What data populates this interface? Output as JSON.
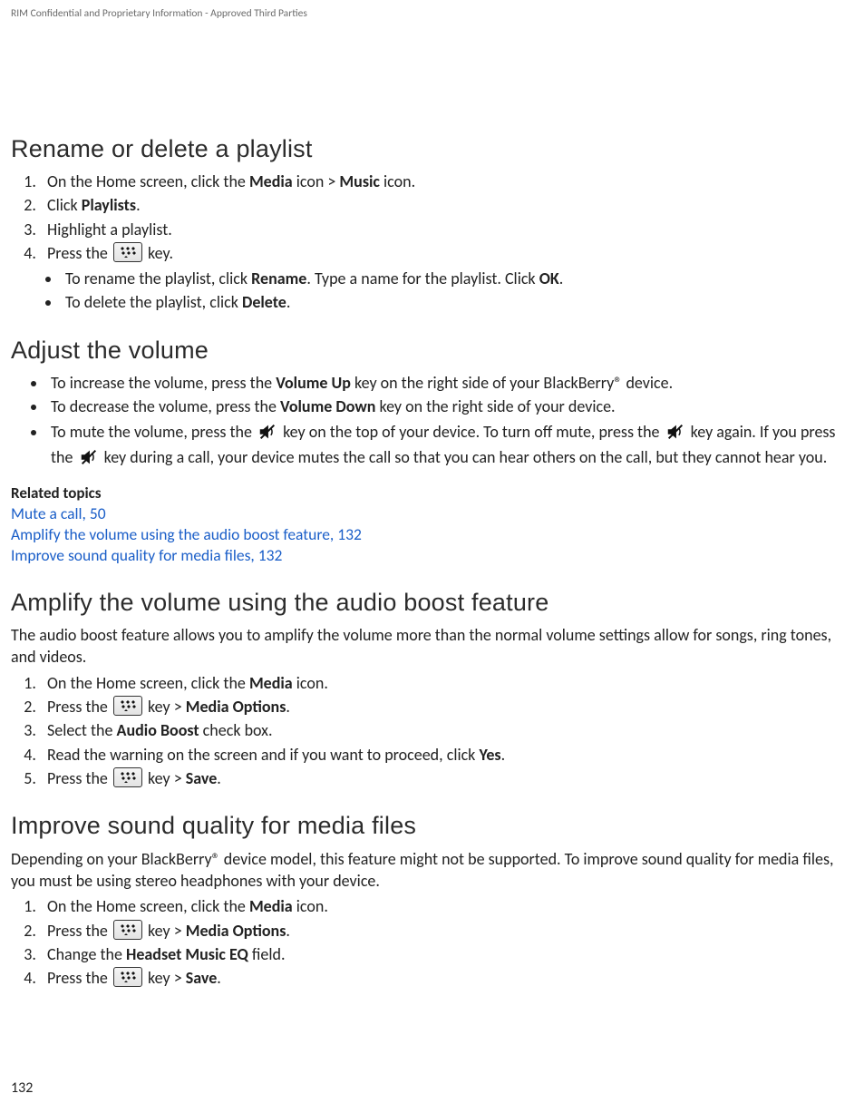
{
  "header": {
    "confidential": "RIM Confidential and Proprietary Information - Approved Third Parties"
  },
  "page_number": "132",
  "sections": {
    "s1": {
      "title": "Rename or delete a playlist",
      "step1_pre": "On the Home screen, click the ",
      "step1_b1": "Media",
      "step1_mid": " icon > ",
      "step1_b2": "Music",
      "step1_post": " icon.",
      "step2_pre": "Click ",
      "step2_b": "Playlists",
      "step2_post": ".",
      "step3": "Highlight a playlist.",
      "step4_pre": "Press the ",
      "step4_post": " key.",
      "sub1_pre": "To rename the playlist, click ",
      "sub1_b1": "Rename",
      "sub1_mid": ". Type a name for the playlist. Click ",
      "sub1_b2": "OK",
      "sub1_post": ".",
      "sub2_pre": "To delete the playlist, click ",
      "sub2_b": "Delete",
      "sub2_post": "."
    },
    "s2": {
      "title": "Adjust the volume",
      "b1_pre": "To increase the volume, press the ",
      "b1_b": "Volume Up",
      "b1_post": " key on the right side of your BlackBerry® device.",
      "b2_pre": "To decrease the volume, press the ",
      "b2_b": "Volume Down",
      "b2_post": " key on the right side of your device.",
      "b3_pre": "To mute the volume, press the ",
      "b3_mid1": " key on the top of your device. To turn off mute, press the ",
      "b3_mid2": " key again. If you press the ",
      "b3_post": " key during a call, your device mutes the call so that you can hear others on the call, but they cannot hear you.",
      "related_head": "Related topics",
      "link1": "Mute a call, 50",
      "link2": "Amplify the volume using the audio boost feature, 132",
      "link3": "Improve sound quality for media files, 132"
    },
    "s3": {
      "title": "Amplify the volume using the audio boost feature",
      "intro": "The audio boost feature allows you to amplify the volume more than the normal volume settings allow for songs, ring tones, and videos.",
      "step1_pre": "On the Home screen, click the ",
      "step1_b": "Media",
      "step1_post": " icon.",
      "step2_pre": "Press the ",
      "step2_mid": " key > ",
      "step2_b": "Media Options",
      "step2_post": ".",
      "step3_pre": "Select the ",
      "step3_b": "Audio Boost",
      "step3_post": " check box.",
      "step4_pre": "Read the warning on the screen and if you want to proceed, click ",
      "step4_b": "Yes",
      "step4_post": ".",
      "step5_pre": "Press the ",
      "step5_mid": " key > ",
      "step5_b": "Save",
      "step5_post": "."
    },
    "s4": {
      "title": "Improve sound quality for media files",
      "intro": "Depending on your BlackBerry® device model, this feature might not be supported. To improve sound quality for media files, you must be using stereo headphones with your device.",
      "step1_pre": "On the Home screen, click the ",
      "step1_b": "Media",
      "step1_post": " icon.",
      "step2_pre": "Press the ",
      "step2_mid": " key > ",
      "step2_b": "Media Options",
      "step2_post": ".",
      "step3_pre": "Change the ",
      "step3_b": "Headset Music EQ",
      "step3_post": " field.",
      "step4_pre": "Press the ",
      "step4_mid": " key > ",
      "step4_b": "Save",
      "step4_post": "."
    }
  }
}
